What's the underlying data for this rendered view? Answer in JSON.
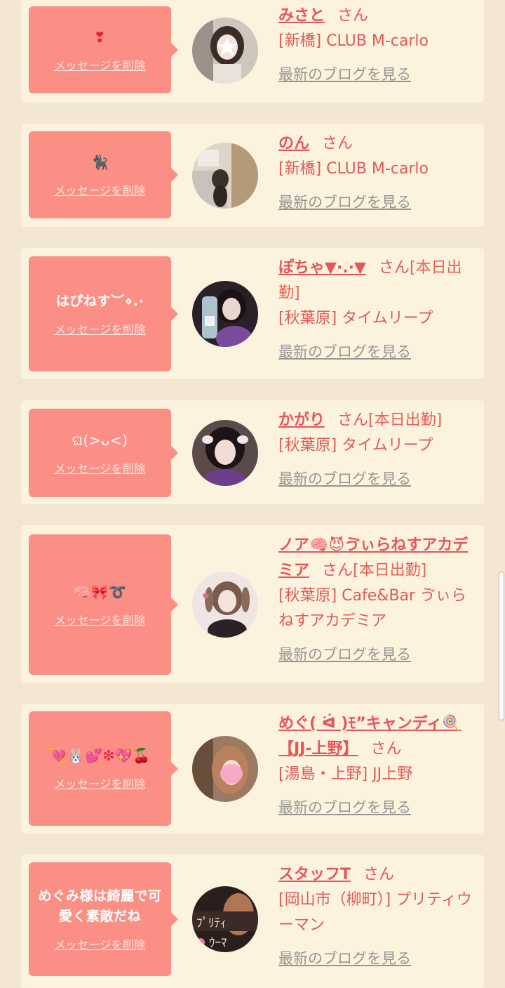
{
  "common": {
    "delete_label": "メッセージを削除",
    "blog_label": "最新のブログを見る",
    "san": "さん"
  },
  "items": [
    {
      "message": "❣",
      "name": "みさと",
      "suffix": "",
      "shop": "[新橋] CLUB M-carlo"
    },
    {
      "message": "🐈‍⬛",
      "name": "のん",
      "suffix": "",
      "shop": "[新橋] CLUB M-carlo"
    },
    {
      "message": "はぴねす︶⋄.·",
      "name": "ぽちゃ▼·.·▼",
      "suffix": "[本日出勤]",
      "shop": "[秋葉原] タイムリープ"
    },
    {
      "message": "ଘ(>ᴗ<)",
      "name": "かがり",
      "suffix": "[本日出勤]",
      "shop": "[秋葉原] タイムリープ"
    },
    {
      "message": "🧠🎀➰",
      "name": "ノア🧠😈ゔぃらねすアカデミア",
      "suffix": "[本日出勤]",
      "shop": "[秋葉原] Cafe&Bar ゔぃらねすアカデミア"
    },
    {
      "message": "💘🐰💕❇💖🍒",
      "name": "めぐ( ᐛ )ﾓ”キャンディ🍭【JJ-上野】",
      "suffix": "",
      "shop": "[湯島・上野] JJ上野"
    },
    {
      "message": "めぐみ様は綺麗で可愛く素敵だね",
      "name": "スタッフT",
      "suffix": "",
      "shop": "[岡山市（柳町）] プリティウーマン"
    }
  ],
  "colors": {
    "background": "#f3e7d2",
    "card": "#fcf3df",
    "bubble": "#fb8f86",
    "accent": "#e9545a",
    "muted": "#979591"
  },
  "icons": [
    "avatar-photo",
    "heart-emoji",
    "black-cat-emoji",
    "brain-emoji",
    "devil-emoji",
    "lollipop-emoji",
    "rabbit-emoji",
    "cherry-emoji"
  ]
}
